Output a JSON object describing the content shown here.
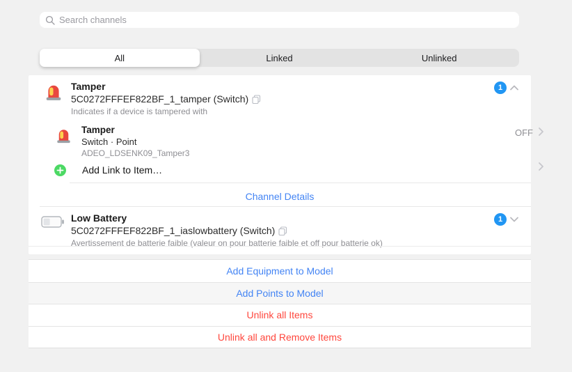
{
  "search": {
    "placeholder": "Search channels",
    "icon": "magnifier"
  },
  "tabs": {
    "all": {
      "label": "All",
      "active": true
    },
    "linked": {
      "label": "Linked",
      "active": false
    },
    "unlinked": {
      "label": "Unlinked",
      "active": false
    }
  },
  "channels": {
    "tamper": {
      "icon": "siren",
      "title": "Tamper",
      "id_line": "5C0272FFFEF822BF_1_tamper (Switch)",
      "description": "Indicates if a device is tampered with",
      "badge": "1",
      "expand_icon": "chevron-up",
      "linked_item": {
        "icon": "siren",
        "title": "Tamper",
        "meta": "Switch · Point",
        "name": "ADEO_LDSENK09_Tamper3",
        "state": "OFF"
      },
      "add_link_label": "Add Link to Item…",
      "details_label": "Channel Details"
    },
    "low_battery": {
      "icon": "battery-low",
      "title": "Low Battery",
      "id_line": "5C0272FFFEF822BF_1_iaslowbattery (Switch)",
      "description": "Avertissement de batterie faible (valeur on pour batterie faible et off pour batterie ok)",
      "badge": "1",
      "expand_icon": "chevron-down"
    }
  },
  "actions": {
    "add_equipment": {
      "label": "Add Equipment to Model",
      "color": "#4384f4"
    },
    "add_points": {
      "label": "Add Points to Model",
      "color": "#4384f4"
    },
    "unlink_all": {
      "label": "Unlink all Items",
      "color": "#ff473d"
    },
    "unlink_remove": {
      "label": "Unlink all and Remove Items",
      "color": "#ff473d"
    }
  },
  "colors": {
    "link_blue": "#4384f4",
    "danger_red": "#ff473d",
    "badge_blue": "#2196f3",
    "add_green": "#4cd964",
    "muted_gray": "#8e8e93"
  }
}
